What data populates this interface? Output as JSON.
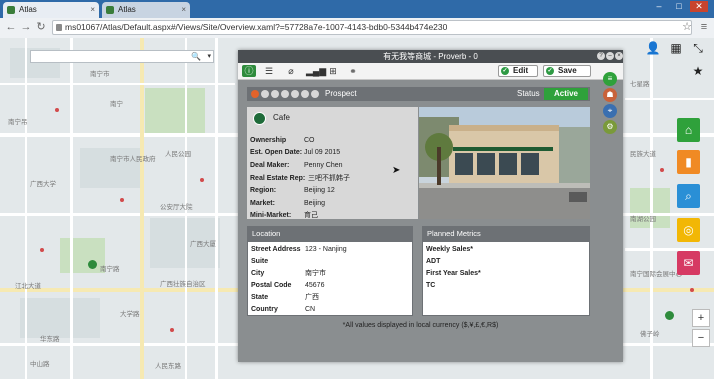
{
  "browser": {
    "tabs": [
      {
        "title": "Atlas"
      },
      {
        "title": "Atlas"
      }
    ],
    "url": "ms01067/Atlas/Default.aspx#/Views/Site/Overview.xaml?=57728a7e-1007-4143-bdb0-5344b474e230",
    "win": {
      "minimize": "–",
      "maximize": "□",
      "close": "✕"
    }
  },
  "map": {
    "labels": [
      "南宁吊",
      "南宁市",
      "人民公园",
      "公安厅大院",
      "广西大学",
      "南宁",
      "江北大道",
      "南宁路",
      "广西壮族自治区",
      "华东路",
      "南宁市人民政府",
      "广西大厦",
      "大学路",
      "七星路",
      "民族大道",
      "南宁国际会展中心",
      "佛子岭",
      "人民东路",
      "中山路",
      "南湖公园"
    ],
    "search": {
      "placeholder": ""
    }
  },
  "panel": {
    "title": "有无我等商城 - Proverb - 0",
    "controls": [
      "?",
      "–",
      "×"
    ],
    "toolbar": {
      "edit": "Edit",
      "save": "Save"
    },
    "stage": {
      "label": "Prospect",
      "status_label": "Status",
      "status_value": "Active",
      "dots": 7,
      "active_dot": 0
    },
    "store": {
      "name": "Cafe",
      "fields": [
        {
          "k": "Ownership",
          "v": "CO"
        },
        {
          "k": "Est. Open Date:",
          "v": "Jul 09 2015"
        },
        {
          "k": "Deal Maker:",
          "v": "Penny Chen"
        },
        {
          "k": "Real Estate Rep:",
          "v": "三吧不抓韩子"
        },
        {
          "k": "Region:",
          "v": "Beijing 12"
        },
        {
          "k": "Market:",
          "v": "Beijing"
        },
        {
          "k": "Mini-Market:",
          "v": "育己"
        }
      ]
    },
    "location": {
      "title": "Location",
      "fields": [
        {
          "k": "Street Address",
          "v": "123 - Nanjing"
        },
        {
          "k": "Suite",
          "v": ""
        },
        {
          "k": "City",
          "v": "南宁市"
        },
        {
          "k": "Postal Code",
          "v": "45676"
        },
        {
          "k": "State",
          "v": "广西"
        },
        {
          "k": "Country",
          "v": "CN"
        }
      ]
    },
    "metrics": {
      "title": "Planned Metrics",
      "fields": [
        {
          "k": "Weekly Sales*"
        },
        {
          "k": "ADT"
        },
        {
          "k": "First Year Sales*"
        },
        {
          "k": "TC"
        }
      ]
    },
    "note": "*All values displayed in local currency ($,¥,£,€,R$)"
  },
  "colors": {
    "accent": "#2fa13b",
    "tabstrip": "#2f6aa8",
    "sideHome": "#2fa13b",
    "sideChart": "#f08a24",
    "sideSearch": "#2a8fd6",
    "sideTarget": "#f2b705",
    "sideChat": "#d63a63"
  }
}
